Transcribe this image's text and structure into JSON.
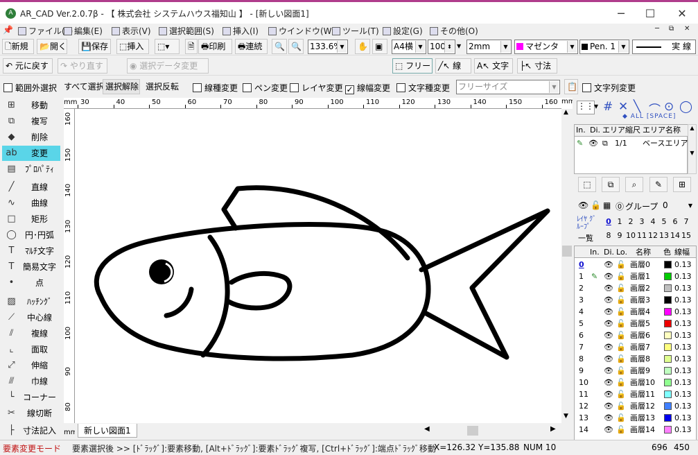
{
  "window": {
    "title": "AR_CAD Ver.2.0.7β - 【 株式会社 システムハウス福知山 】 - [新しい図面1]",
    "logo": "A"
  },
  "menu": [
    {
      "label": "ファイル(F)"
    },
    {
      "label": "編集(E)"
    },
    {
      "label": "表示(V)"
    },
    {
      "label": "選択範囲(S)"
    },
    {
      "label": "挿入(I)"
    },
    {
      "label": "ウインドウ(W)"
    },
    {
      "label": "ツール(T)"
    },
    {
      "label": "設定(G)"
    },
    {
      "label": "その他(O)"
    }
  ],
  "toolbar1": {
    "new": "新規",
    "open": "開く",
    "save": "保存",
    "insert": "挿入",
    "print": "印刷",
    "continuous": "連続",
    "zoom": "133.6%",
    "paper": "A4横",
    "scale": "100",
    "grid": "2mm",
    "color_name": "マゼンタ",
    "color_hex": "#ff00ff",
    "pen": "Pen. 1",
    "line_type": "実  線"
  },
  "toolbar2": {
    "undo": "元に戻す",
    "redo": "やり直す",
    "sel_change": "選択データ変更",
    "free": "フリー",
    "line": "線",
    "text": "文字",
    "dim": "寸法"
  },
  "toolbar3": {
    "out_of_range": "範囲外選択",
    "select_all": "すべて選択",
    "deselect": "選択解除",
    "invert": "選択反転",
    "line_type_change": "線種変更",
    "pen_change": "ペン変更",
    "layer_change": "レイヤ変更",
    "line_width_change": "線幅変更",
    "font_change": "文字種変更",
    "size": "フリーサイズ",
    "string_change": "文字列変更"
  },
  "left_tools": [
    {
      "label": "移動",
      "icon": "move-icon",
      "glyph": "⊞"
    },
    {
      "label": "複写",
      "icon": "copy-icon",
      "glyph": "⧉"
    },
    {
      "label": "削除",
      "icon": "delete-icon",
      "glyph": "◆"
    },
    {
      "label": "変更",
      "icon": "change-icon",
      "glyph": "ab",
      "active": true
    },
    {
      "label": "ﾌﾟﾛﾊﾟﾃｨ",
      "icon": "property-icon",
      "glyph": "▤"
    },
    {
      "label": "直線",
      "icon": "line-icon",
      "glyph": "╱"
    },
    {
      "label": "曲線",
      "icon": "curve-icon",
      "glyph": "∿"
    },
    {
      "label": "矩形",
      "icon": "rect-icon",
      "glyph": "□"
    },
    {
      "label": "円･円弧",
      "icon": "circle-icon",
      "glyph": "◯"
    },
    {
      "label": "ﾏﾙﾁ文字",
      "icon": "multitext-icon",
      "glyph": "T"
    },
    {
      "label": "簡易文字",
      "icon": "text-icon",
      "glyph": "T"
    },
    {
      "label": "点",
      "icon": "point-icon",
      "glyph": "•"
    },
    {
      "label": "ﾊｯﾁﾝｸﾞ",
      "icon": "hatch-icon",
      "glyph": "▨"
    },
    {
      "label": "中心線",
      "icon": "centerline-icon",
      "glyph": "⟋"
    },
    {
      "label": "複線",
      "icon": "offset-icon",
      "glyph": "⫽"
    },
    {
      "label": "面取",
      "icon": "chamfer-icon",
      "glyph": "⌞"
    },
    {
      "label": "伸縮",
      "icon": "extend-icon",
      "glyph": "⤢"
    },
    {
      "label": "巾線",
      "icon": "width-line-icon",
      "glyph": "⫻"
    },
    {
      "label": "コーナー",
      "icon": "corner-icon",
      "glyph": "└"
    },
    {
      "label": "線切断",
      "icon": "cut-icon",
      "glyph": "✂"
    },
    {
      "label": "寸法記入",
      "icon": "dimension-icon",
      "glyph": "├"
    }
  ],
  "ruler": {
    "unit": "mm",
    "h_ticks": [
      "30",
      "40",
      "50",
      "60",
      "70",
      "80",
      "90",
      "100",
      "110",
      "120",
      "130",
      "140",
      "150",
      "160"
    ],
    "v_ticks": [
      "160",
      "150",
      "140",
      "130",
      "120",
      "110",
      "100",
      "90",
      "80"
    ]
  },
  "drawing_tab": "新しい図面1",
  "right_panel": {
    "all_label": "ALL",
    "space_label": "[SPACE]",
    "area_headers": [
      "In.",
      "Di.",
      "エリア縮尺",
      "エリア名称"
    ],
    "area_row": {
      "scale": "1/1",
      "name": "ベースエリア"
    },
    "group_label": "グループ",
    "group_index": "0",
    "group_value": "0",
    "layer_group_label": "ﾚｲﾔ ｸﾞﾙｰﾌﾟ",
    "list_label": "一覧",
    "group_nums": [
      "0",
      "1",
      "2",
      "3",
      "4",
      "5",
      "6",
      "7",
      "8",
      "9",
      "10",
      "11",
      "12",
      "13",
      "14",
      "15"
    ],
    "layer_headers": [
      "In.",
      "Di.",
      "Lo.",
      "名称",
      "色",
      "線幅"
    ],
    "layers": [
      {
        "no": "0",
        "name": "画層0",
        "color": "#000000",
        "width": "0.13"
      },
      {
        "no": "1",
        "name": "画層1",
        "color": "#00cc00",
        "width": "0.13"
      },
      {
        "no": "2",
        "name": "画層2",
        "color": "#c0c0c0",
        "width": "0.13"
      },
      {
        "no": "3",
        "name": "画層3",
        "color": "#000000",
        "width": "0.13"
      },
      {
        "no": "4",
        "name": "画層4",
        "color": "#ff00ff",
        "width": "0.13"
      },
      {
        "no": "5",
        "name": "画層5",
        "color": "#ee0000",
        "width": "0.13"
      },
      {
        "no": "6",
        "name": "画層6",
        "color": "#ffffc0",
        "width": "0.13"
      },
      {
        "no": "7",
        "name": "画層7",
        "color": "#ffff80",
        "width": "0.13"
      },
      {
        "no": "8",
        "name": "画層8",
        "color": "#e0ff90",
        "width": "0.13"
      },
      {
        "no": "9",
        "name": "画層9",
        "color": "#c0ffc0",
        "width": "0.13"
      },
      {
        "no": "10",
        "name": "画層10",
        "color": "#90ff90",
        "width": "0.13"
      },
      {
        "no": "11",
        "name": "画層11",
        "color": "#80ffff",
        "width": "0.13"
      },
      {
        "no": "12",
        "name": "画層12",
        "color": "#4080ff",
        "width": "0.13"
      },
      {
        "no": "13",
        "name": "画層13",
        "color": "#0000ee",
        "width": "0.13"
      },
      {
        "no": "14",
        "name": "画層14",
        "color": "#ff80ff",
        "width": "0.13"
      }
    ]
  },
  "status": {
    "mode": "要素変更モード",
    "hint": "要素選択後 >> [ﾄﾞﾗｯｸﾞ]:要素移動, [Alt+ﾄﾞﾗｯｸﾞ]:要素ﾄﾞﾗｯｸﾞ複写, [Ctrl+ﾄﾞﾗｯｸﾞ]:端点ﾄﾞﾗｯｸﾞ移動",
    "x": "X=126.32",
    "y": "Y=135.88",
    "num": "NUM 10",
    "w": "696",
    "h": "450"
  }
}
